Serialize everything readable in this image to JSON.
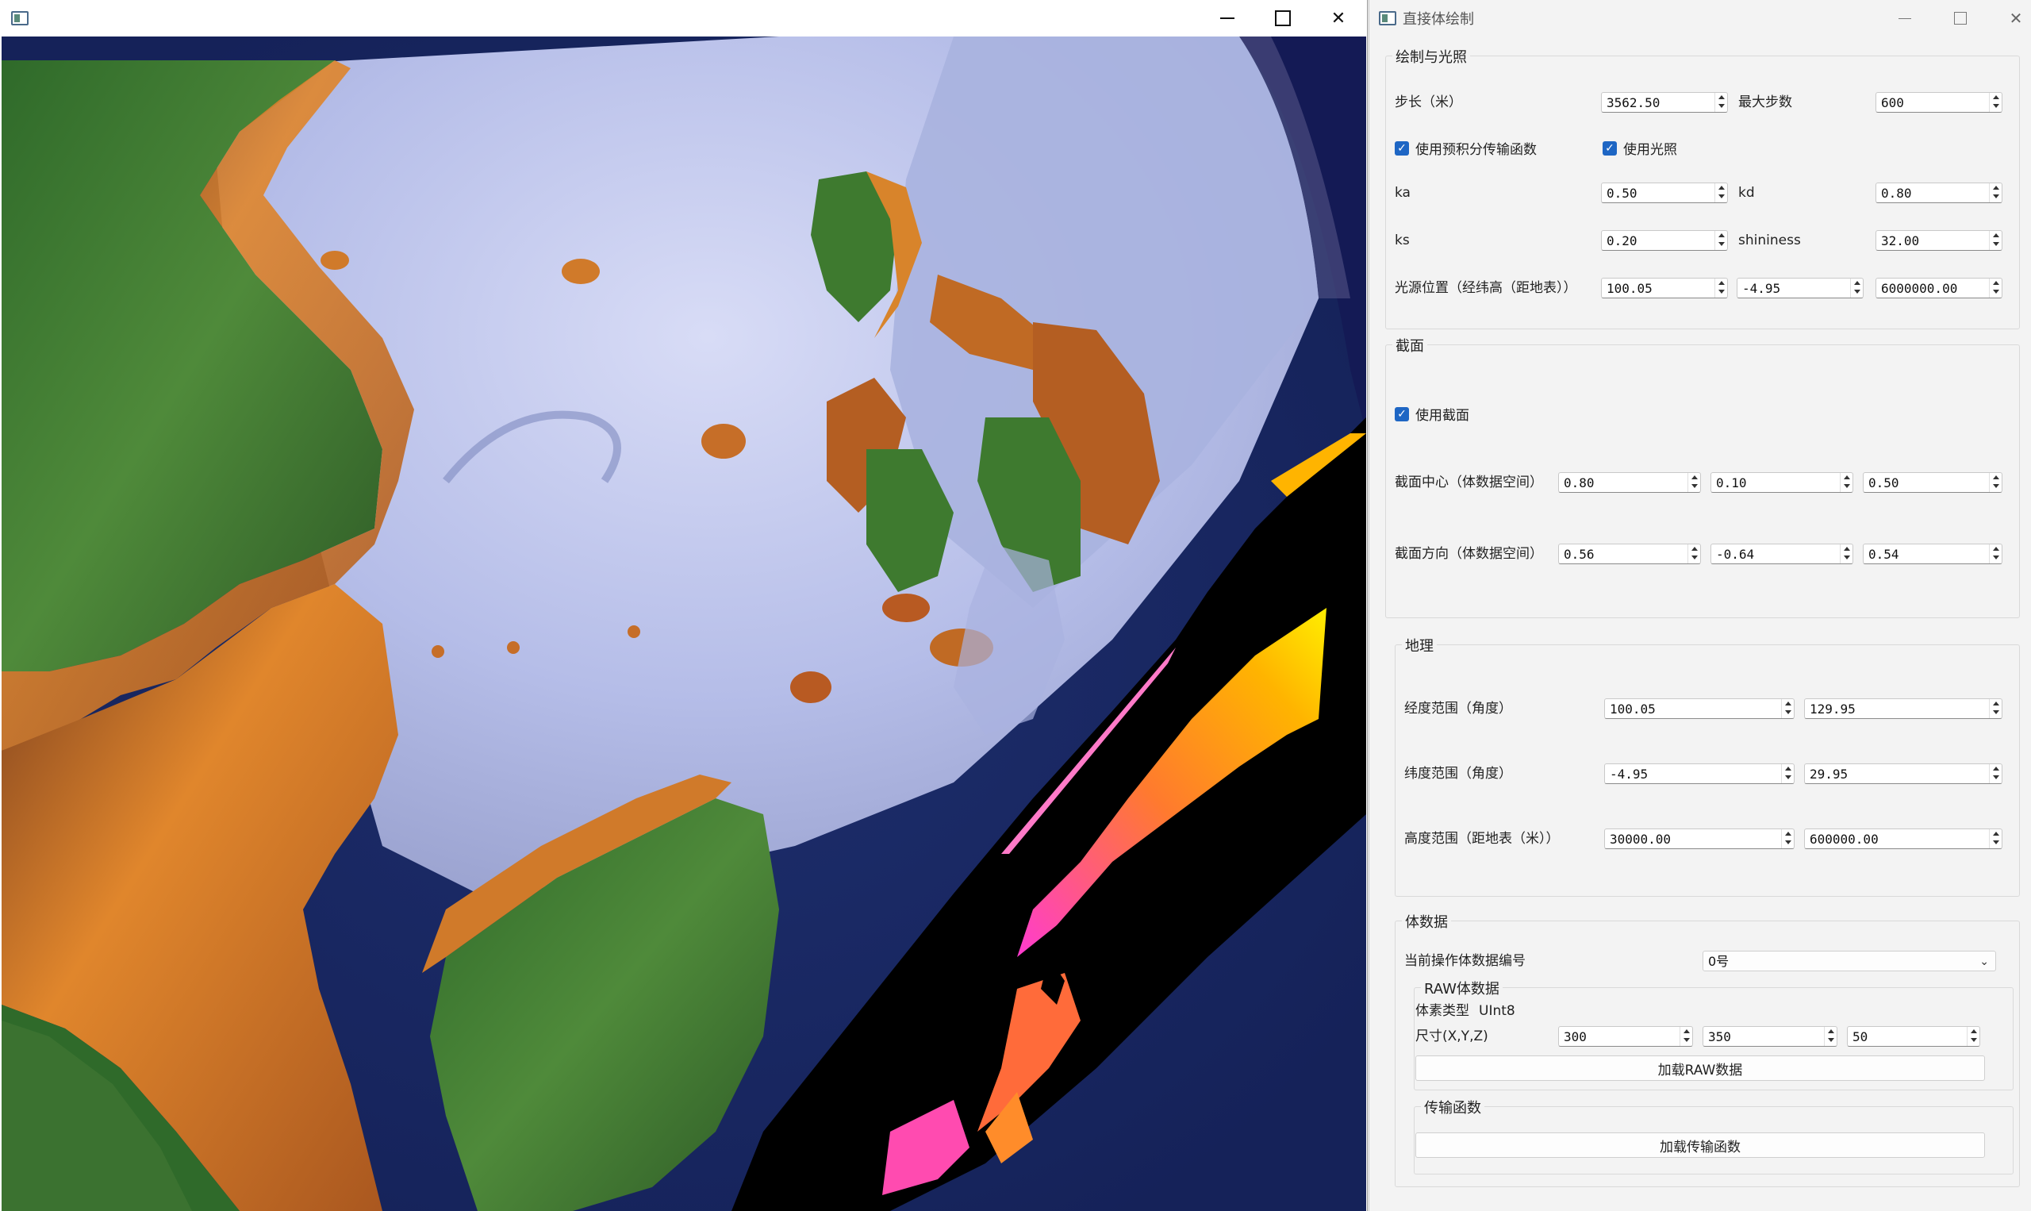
{
  "render_window": {
    "buttons": {
      "minimize": "minimize",
      "maximize": "maximize",
      "close": "close"
    }
  },
  "panel": {
    "title": "直接体绘制",
    "render_lighting": {
      "title": "绘制与光照",
      "step_label": "步长（米）",
      "step_value": "3562.50",
      "max_steps_label": "最大步数",
      "max_steps_value": "600",
      "preintegrated_label": "使用预积分传输函数",
      "preintegrated_checked": true,
      "lighting_label": "使用光照",
      "lighting_checked": true,
      "ka_label": "ka",
      "ka_value": "0.50",
      "kd_label": "kd",
      "kd_value": "0.80",
      "ks_label": "ks",
      "ks_value": "0.20",
      "shininess_label": "shininess",
      "shininess_value": "32.00",
      "light_pos_label": "光源位置（经纬高（距地表））",
      "light_pos_values": [
        "100.05",
        "-4.95",
        "6000000.00"
      ]
    },
    "slice": {
      "title": "截面",
      "use_slice_label": "使用截面",
      "use_slice_checked": true,
      "center_label": "截面中心（体数据空间）",
      "center_values": [
        "0.80",
        "0.10",
        "0.50"
      ],
      "direction_label": "截面方向（体数据空间）",
      "direction_values": [
        "0.56",
        "-0.64",
        "0.54"
      ]
    },
    "geo": {
      "title": "地理",
      "lon_label": "经度范围（角度）",
      "lon_values": [
        "100.05",
        "129.95"
      ],
      "lat_label": "纬度范围（角度）",
      "lat_values": [
        "-4.95",
        "29.95"
      ],
      "height_label": "高度范围（距地表（米））",
      "height_values": [
        "30000.00",
        "600000.00"
      ]
    },
    "volume": {
      "title": "体数据",
      "current_label": "当前操作体数据编号",
      "current_value": "0号",
      "raw": {
        "title": "RAW体数据",
        "voxel_type_label": "体素类型",
        "voxel_type_value": "UInt8",
        "size_label": "尺寸(X,Y,Z)",
        "size_values": [
          "300",
          "350",
          "50"
        ],
        "load_raw_label": "加载RAW数据"
      },
      "tf": {
        "title": "传输函数",
        "load_tf_label": "加载传输函数"
      }
    }
  },
  "colors": {
    "checkbox_blue": "#1e66c4",
    "space": "#141a55",
    "land_green": "#3f7a2e",
    "ocean_volume": "#b8c2ee",
    "coast_orange": "#d9822b",
    "slice_magenta": "#ff3bd0",
    "slice_yellow": "#ffee00"
  }
}
